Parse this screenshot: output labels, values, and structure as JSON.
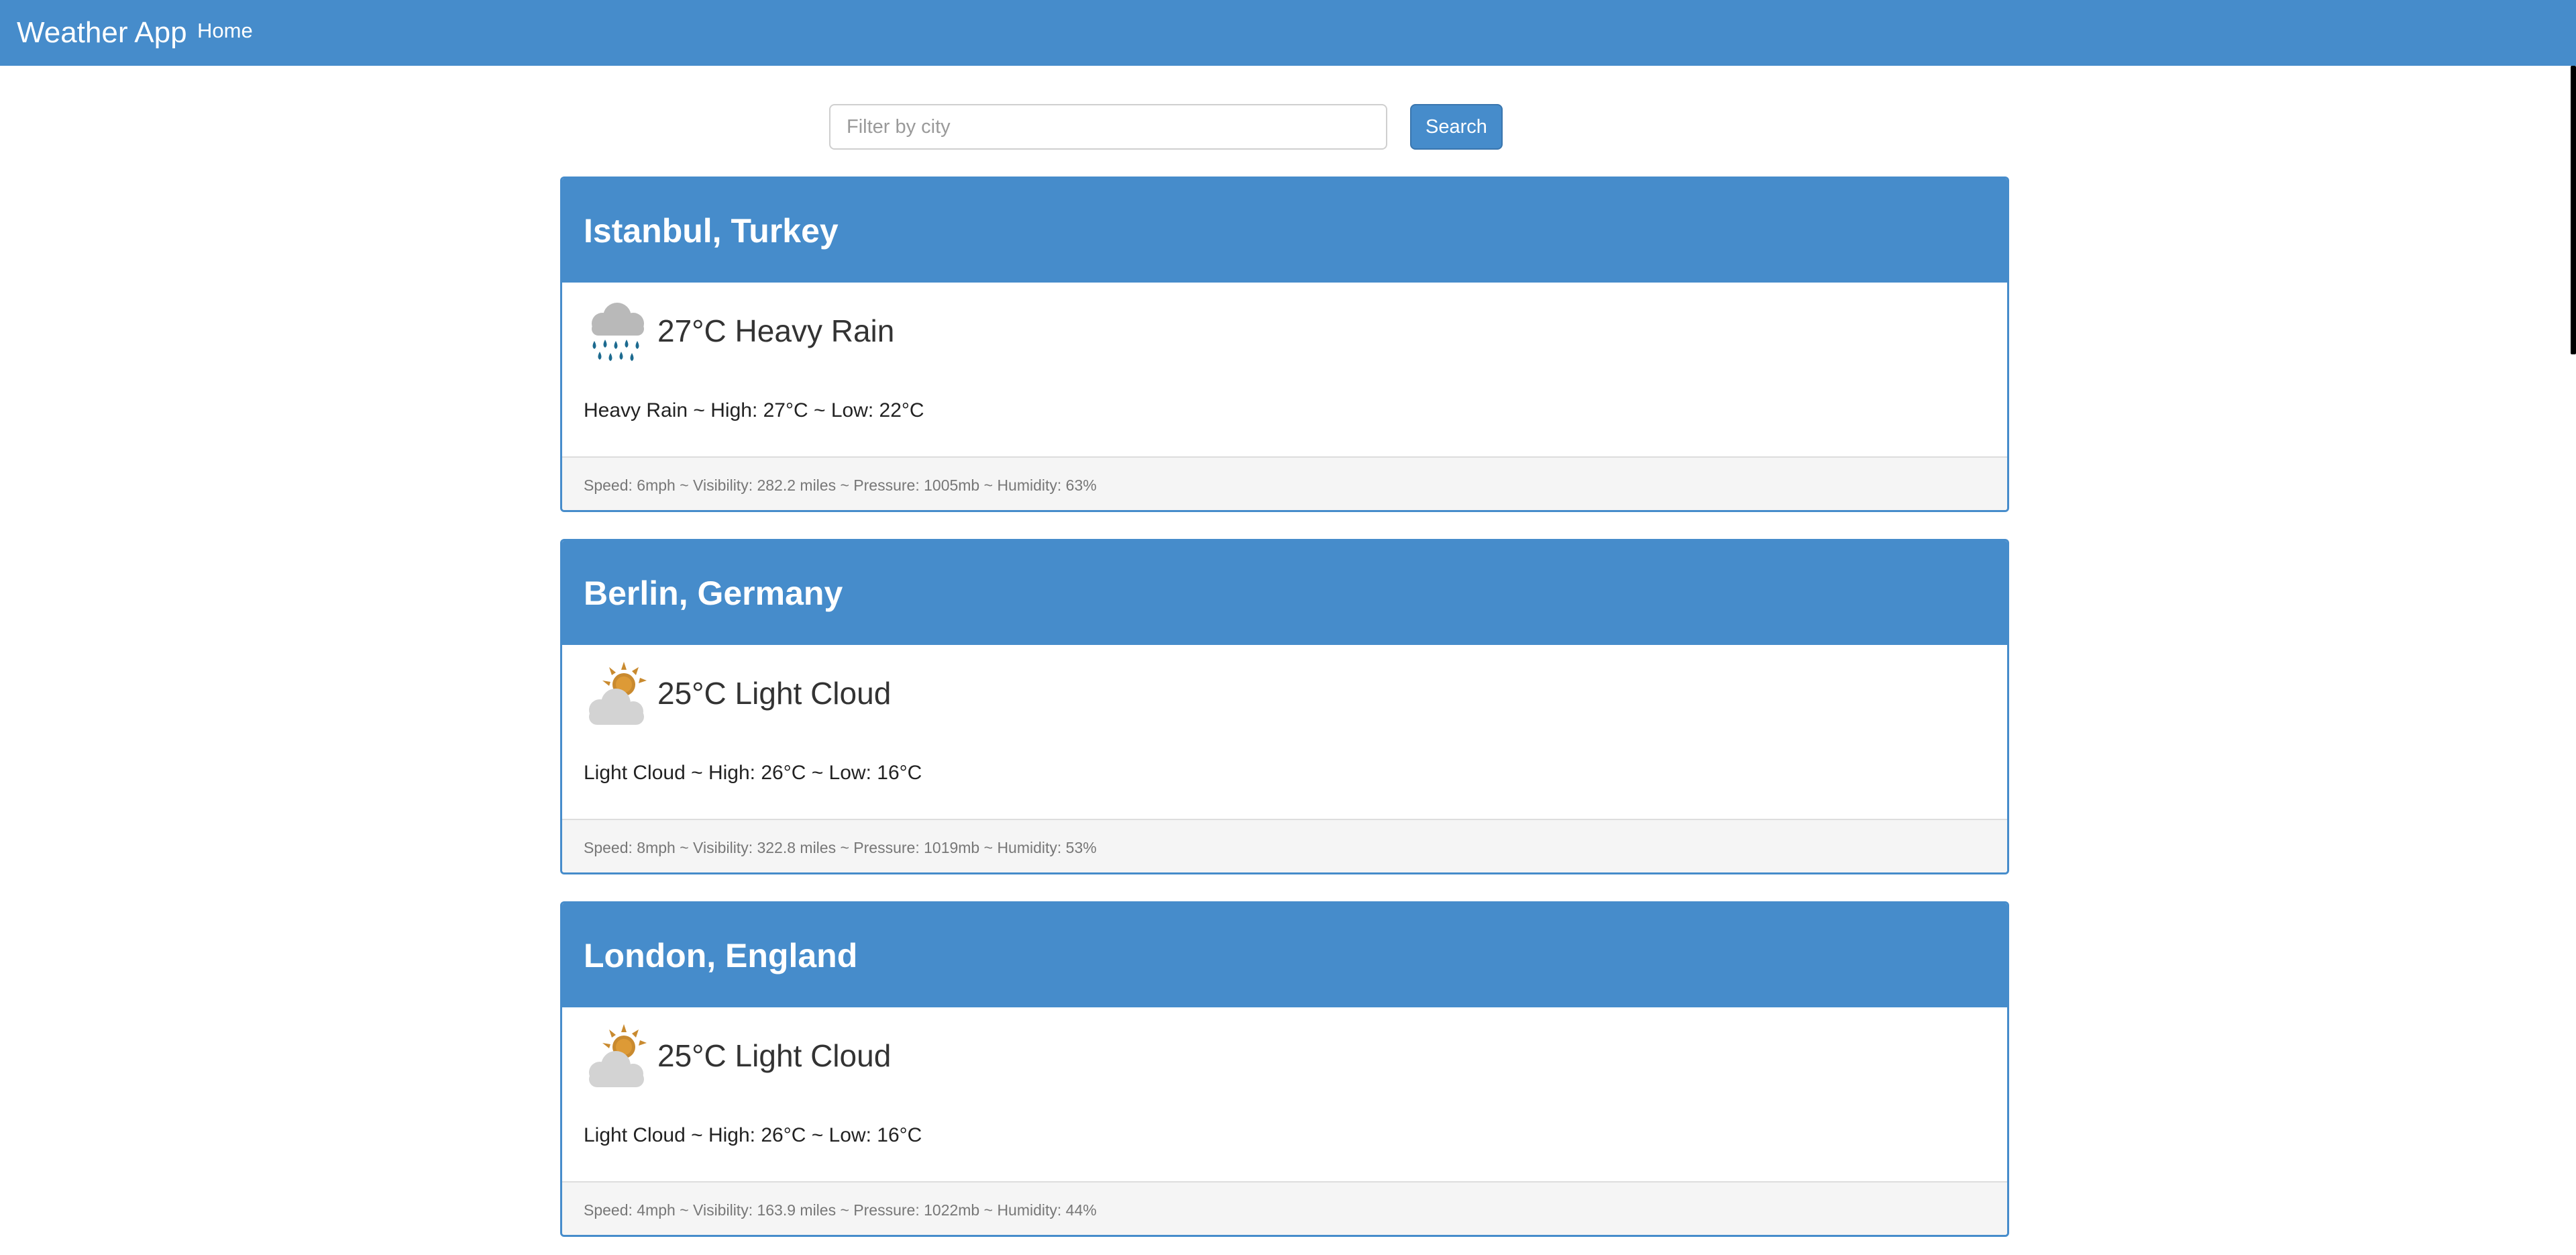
{
  "navbar": {
    "brand": "Weather App",
    "home": "Home",
    "background": "#468ccb"
  },
  "search": {
    "placeholder": "Filter by city",
    "value": "",
    "button_label": "Search"
  },
  "cities": [
    {
      "title": "Istanbul, Turkey",
      "icon": "heavy-rain-icon",
      "headline": "27°C Heavy Rain",
      "summary": "Heavy Rain ~  High: 27°C ~  Low: 22°C",
      "details": "Speed: 6mph ~  Visibility: 282.2 miles ~  Pressure: 1005mb ~  Humidity: 63%"
    },
    {
      "title": "Berlin, Germany",
      "icon": "light-cloud-icon",
      "headline": "25°C Light Cloud",
      "summary": "Light Cloud ~  High: 26°C ~  Low: 16°C",
      "details": "Speed: 8mph ~  Visibility: 322.8 miles ~  Pressure: 1019mb ~  Humidity: 53%"
    },
    {
      "title": "London, England",
      "icon": "light-cloud-icon",
      "headline": "25°C Light Cloud",
      "summary": "Light Cloud ~  High: 26°C ~  Low: 16°C",
      "details": "Speed: 4mph ~  Visibility: 163.9 miles ~  Pressure: 1022mb ~  Humidity: 44%"
    }
  ]
}
